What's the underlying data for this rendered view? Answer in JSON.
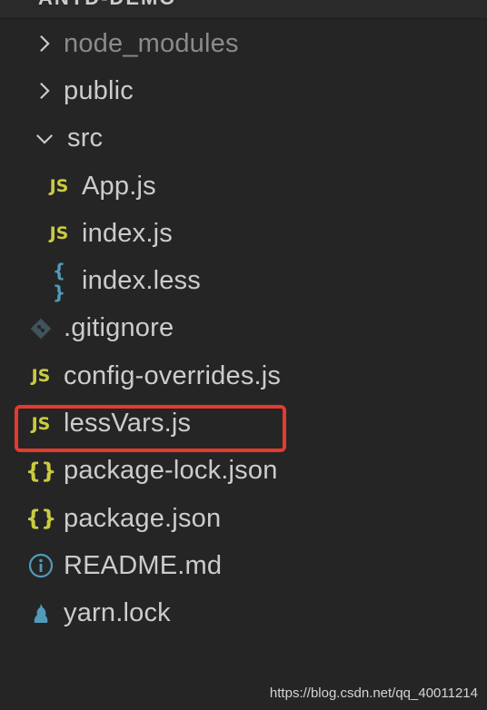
{
  "explorer": {
    "project_title": "ANTD-DEMO",
    "items": [
      {
        "label": "node_modules",
        "icon": "chevron-right-icon"
      },
      {
        "label": "public",
        "icon": "chevron-right-icon"
      },
      {
        "label": "src",
        "icon": "chevron-down-icon"
      },
      {
        "label": "App.js",
        "badge": "JS"
      },
      {
        "label": "index.js",
        "badge": "JS"
      },
      {
        "label": "index.less",
        "badge": "{ }"
      },
      {
        "label": ".gitignore",
        "icon": "git-icon"
      },
      {
        "label": "config-overrides.js",
        "badge": "JS"
      },
      {
        "label": "lessVars.js",
        "badge": "JS"
      },
      {
        "label": "package-lock.json",
        "badge": "{}"
      },
      {
        "label": "package.json",
        "badge": "{}"
      },
      {
        "label": "README.md",
        "icon": "info-icon"
      },
      {
        "label": "yarn.lock",
        "icon": "yarn-icon"
      }
    ]
  },
  "watermark": "https://blog.csdn.net/qq_40011214",
  "colors": {
    "background": "#252526",
    "js_yellow": "#cbcb41",
    "less_blue": "#519aba",
    "highlight_red": "#e33b2e"
  }
}
